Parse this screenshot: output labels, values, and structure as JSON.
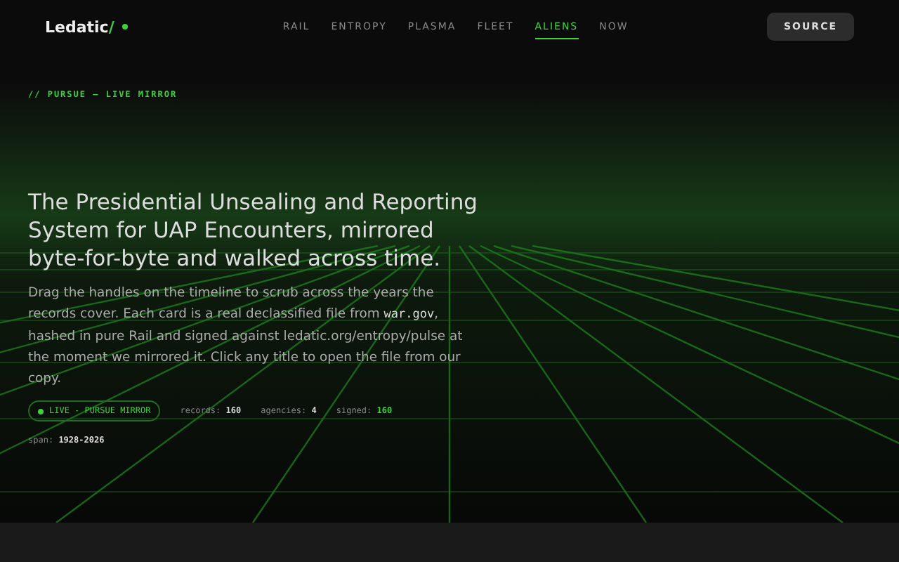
{
  "brand": {
    "name": "Ledatic",
    "slash": "/"
  },
  "nav": [
    {
      "label": "RAIL",
      "selected": false
    },
    {
      "label": "ENTROPY",
      "selected": false
    },
    {
      "label": "PLASMA",
      "selected": false
    },
    {
      "label": "FLEET",
      "selected": false
    },
    {
      "label": "ALIENS",
      "selected": true
    },
    {
      "label": "NOW",
      "selected": false
    }
  ],
  "source_button": "SOURCE",
  "eyebrow": "// PURSUE — LIVE MIRROR",
  "headline": "The Presidential Unsealing and Reporting System for UAP Encounters, mirrored byte-for-byte and walked across time.",
  "description": [
    {
      "kind": "text",
      "text": "Drag the handles on the timeline to scrub across the years the records cover. Each card is a real declassified file from "
    },
    {
      "kind": "code",
      "text": "war.gov"
    },
    {
      "kind": "text",
      "text": ", hashed in pure Rail and signed against ledatic.org/entropy/pulse at the moment we mirrored it. Click any title to open the file from our copy."
    }
  ],
  "live_badge": "LIVE - PURSUE MIRROR",
  "stats": [
    {
      "label": "records:",
      "value": "160",
      "highlight": false
    },
    {
      "label": "agencies:",
      "value": "4",
      "highlight": false
    },
    {
      "label": "signed:",
      "value": "160",
      "highlight": true
    }
  ],
  "span": {
    "label": "span:",
    "value": "1928-2026"
  }
}
